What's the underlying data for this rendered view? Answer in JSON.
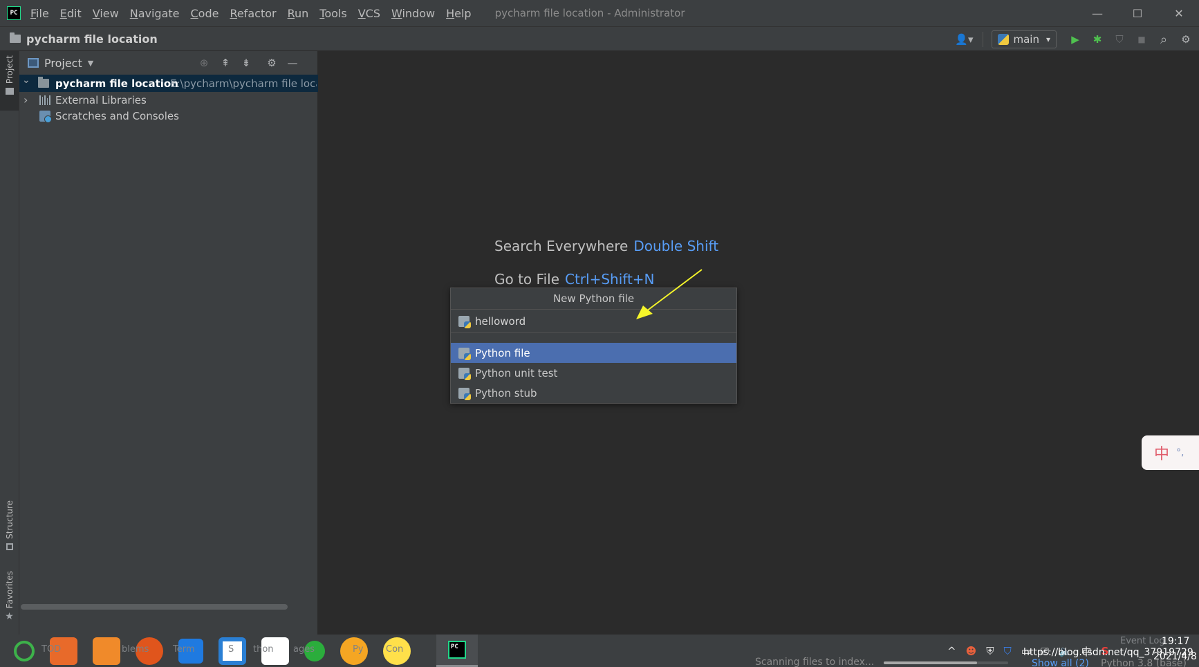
{
  "menubar": {
    "logo_text": "PC",
    "items": [
      {
        "label": "File"
      },
      {
        "label": "Edit"
      },
      {
        "label": "View"
      },
      {
        "label": "Navigate"
      },
      {
        "label": "Code"
      },
      {
        "label": "Refactor"
      },
      {
        "label": "Run"
      },
      {
        "label": "Tools"
      },
      {
        "label": "VCS"
      },
      {
        "label": "Window"
      },
      {
        "label": "Help"
      }
    ],
    "window_title": "pycharm file location - Administrator",
    "minimize_glyph": "—",
    "maximize_glyph": "☐",
    "close_glyph": "✕"
  },
  "navbar": {
    "project_name": "pycharm file location",
    "run_config": "main",
    "run_config_chevron": "▾",
    "user_icon_glyph": "👤▾",
    "run_glyph": "▶",
    "debug_glyph": "✱",
    "coverage_glyph": "⛉",
    "stop_glyph": "■",
    "search_glyph": "⌕",
    "settings_glyph": "⚙"
  },
  "left_strip": {
    "project_tab": "Project",
    "structure_tab": "Structure",
    "favorites_tab": "Favorites",
    "favorites_star": "★"
  },
  "project_panel": {
    "title": "Project",
    "dropdown_glyph": "▼",
    "tools": {
      "locate": "⊕",
      "expand": "⇞",
      "collapse": "⇟",
      "settings": "⚙",
      "hide": "—"
    },
    "tree": [
      {
        "label": "pycharm file location",
        "path": "E:\\pycharm\\pycharm file location",
        "chevron": "⌄"
      },
      {
        "label": "External Libraries",
        "chevron": "›"
      },
      {
        "label": "Scratches and Consoles"
      }
    ]
  },
  "editor": {
    "hints": [
      {
        "label": "Search Everywhere",
        "key": "Double Shift"
      },
      {
        "label": "Go to File",
        "key": "Ctrl+Shift+N"
      }
    ]
  },
  "popup": {
    "title": "New Python file",
    "input_value": "helloword",
    "items": [
      {
        "label": "Python file",
        "selected": true
      },
      {
        "label": "Python unit test",
        "selected": false
      },
      {
        "label": "Python stub",
        "selected": false
      }
    ]
  },
  "annotation": {
    "arrow_color": "#f5f52a"
  },
  "ime": {
    "char": "中",
    "dot": "°,"
  },
  "status": {
    "scanning": "Scanning files to index...",
    "scan_progress": 0.75,
    "show_all": "Show all (2)",
    "interpreter": "Python 3.8 (base)"
  },
  "taskbar": {
    "ghost_labels": [
      "TOD",
      "blems",
      "Term",
      "S",
      "thon",
      "ages",
      "Py",
      "Con"
    ],
    "tray_glyphs": [
      "^",
      "☻",
      "⛨",
      "⛉",
      "▭",
      "⎚",
      "🔈",
      "中",
      "S"
    ],
    "event_log": "Event Log",
    "url": "https://blog.csdn.net/qq_37919729",
    "time": "19:17",
    "date": "2021/4/8"
  },
  "colors": {
    "accent_blue": "#589df6",
    "selection_blue": "#4b6eaf",
    "panel_bg": "#3c3f41",
    "editor_bg": "#2b2b2b",
    "run_green": "#4fc14f"
  }
}
